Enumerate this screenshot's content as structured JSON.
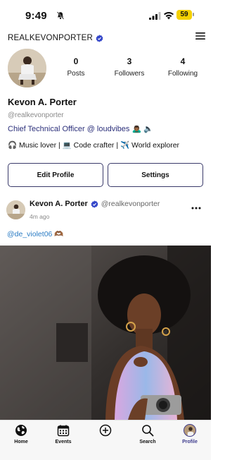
{
  "status_bar": {
    "time": "9:49",
    "battery": "59"
  },
  "header": {
    "username": "REALKEVONPORTER"
  },
  "stats": [
    {
      "count": "0",
      "label": "Posts"
    },
    {
      "count": "3",
      "label": "Followers"
    },
    {
      "count": "4",
      "label": "Following"
    }
  ],
  "profile": {
    "name": "Kevon A. Porter",
    "handle": "@realkevonporter",
    "title": "Chief Technical Officer @ loudvibes",
    "title_emoji": "🙇🏾‍♂️ 🔈",
    "interests": "🎧 Music lover | 💻 Code crafter | ✈️ World explorer"
  },
  "buttons": {
    "edit": "Edit Profile",
    "settings": "Settings"
  },
  "post": {
    "author": "Kevon A. Porter",
    "handle": "@realkevonporter",
    "time": "4m ago",
    "mention": "@de_violet06",
    "mention_emoji": "🫶🏾"
  },
  "tabs": [
    {
      "label": "Home",
      "icon": "globe-icon"
    },
    {
      "label": "Events",
      "icon": "calendar-icon"
    },
    {
      "label": "",
      "icon": "plus-circle-icon"
    },
    {
      "label": "Search",
      "icon": "search-icon"
    },
    {
      "label": "Profile",
      "icon": "avatar",
      "active": true
    }
  ],
  "colors": {
    "accent": "#3c3a8c",
    "link": "#2b7cc4",
    "verified": "#3346c9",
    "battery": "#f4d000"
  }
}
